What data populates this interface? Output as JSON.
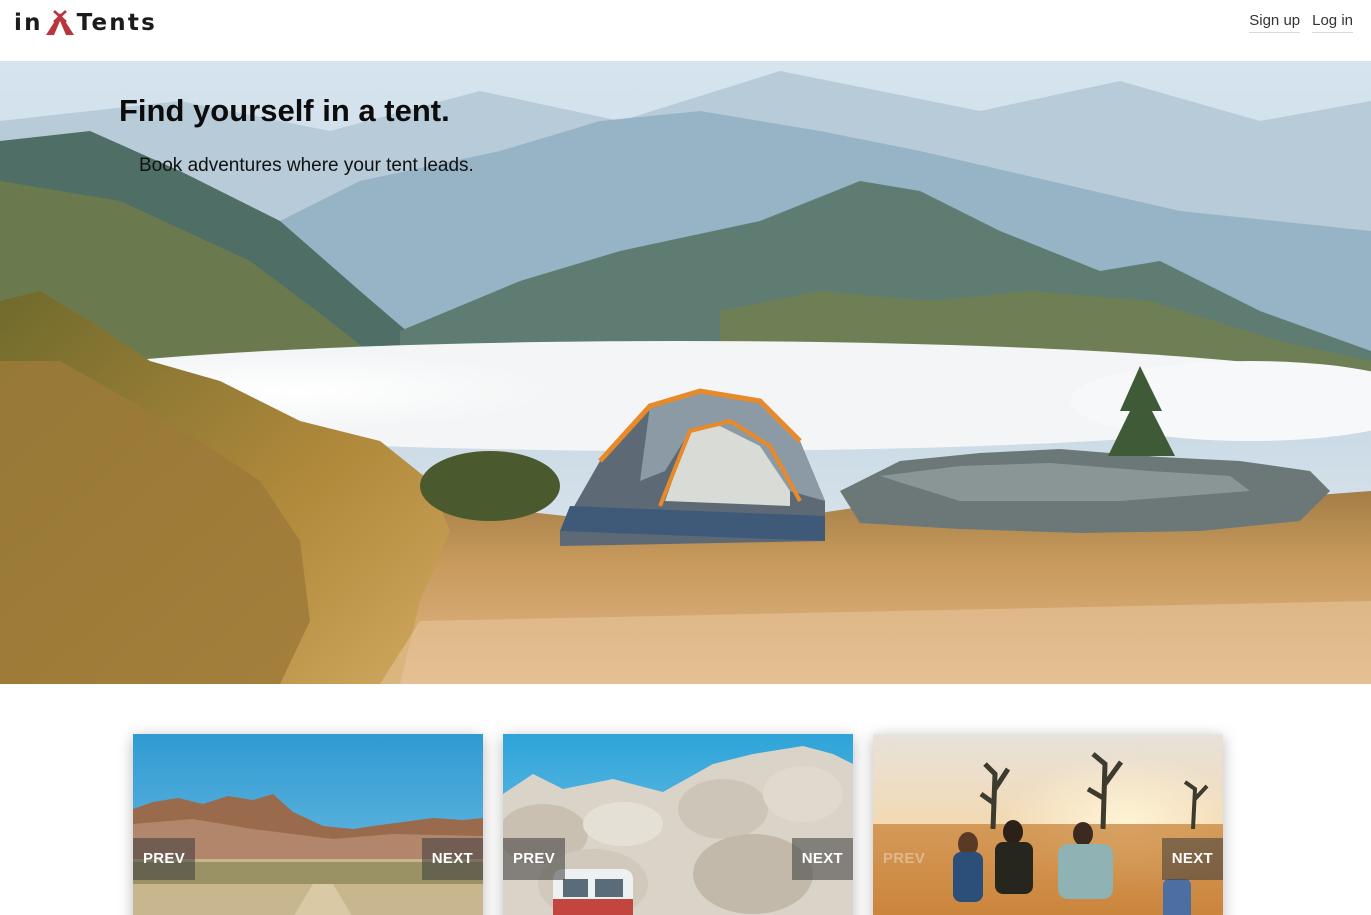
{
  "brand": {
    "prefix": "in",
    "suffix": "Tents",
    "accent_color": "#b8363c"
  },
  "nav": {
    "signup_label": "Sign up",
    "login_label": "Log in"
  },
  "hero": {
    "title": "Find yourself in a tent.",
    "subtitle": "Book adventures where your tent leads."
  },
  "cards": [
    {
      "prev_label": "PREV",
      "next_label": "NEXT"
    },
    {
      "prev_label": "PREV",
      "next_label": "NEXT"
    },
    {
      "prev_label": "PREV",
      "next_label": "NEXT"
    }
  ]
}
